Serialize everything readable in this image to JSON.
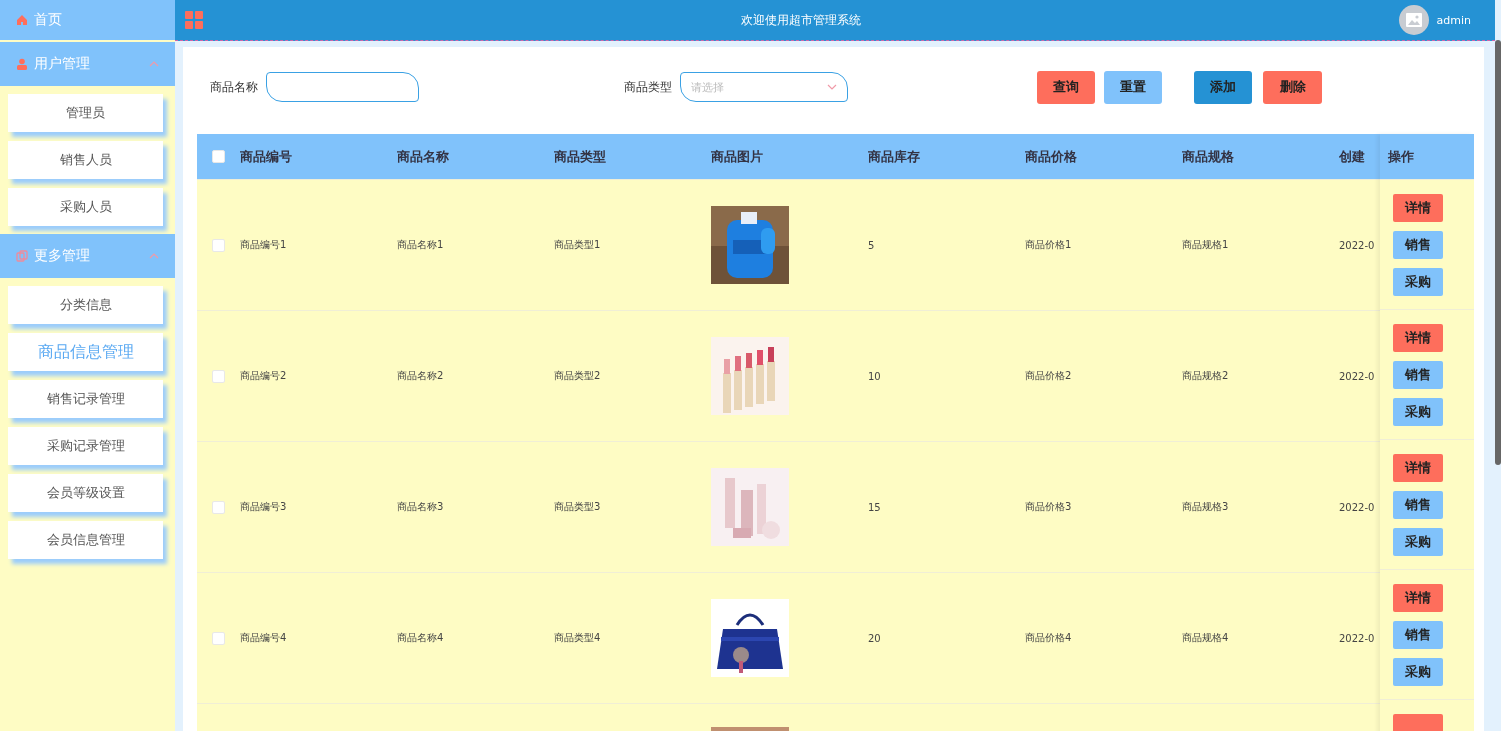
{
  "header": {
    "title": "欢迎使用超市管理系统",
    "user": "admin"
  },
  "sidebar": {
    "items": [
      {
        "label": "首页"
      },
      {
        "label": "用户管理",
        "expanded": true,
        "children": [
          {
            "label": "管理员",
            "selected": false
          },
          {
            "label": "销售人员",
            "selected": false
          },
          {
            "label": "采购人员",
            "selected": false
          }
        ]
      },
      {
        "label": "更多管理",
        "expanded": true,
        "children": [
          {
            "label": "分类信息",
            "selected": false
          },
          {
            "label": "商品信息管理",
            "selected": true
          },
          {
            "label": "销售记录管理",
            "selected": false
          },
          {
            "label": "采购记录管理",
            "selected": false
          },
          {
            "label": "会员等级设置",
            "selected": false
          },
          {
            "label": "会员信息管理",
            "selected": false
          }
        ]
      }
    ]
  },
  "search": {
    "fields": [
      {
        "label": "商品名称",
        "kind": "text"
      },
      {
        "label": "商品类型",
        "kind": "select",
        "placeholder": "请选择"
      }
    ],
    "buttons": [
      {
        "label": "查询",
        "color": "#fe6e5c"
      },
      {
        "label": "重置",
        "color": "#80c2fb"
      },
      {
        "label": "添加",
        "color": "#2592d4"
      },
      {
        "label": "删除",
        "color": "#fe6e5c"
      }
    ]
  },
  "table": {
    "select_all": {
      "checked": false
    },
    "columns": [
      "商品编号",
      "商品名称",
      "商品类型",
      "商品图片",
      "商品库存",
      "商品价格",
      "商品规格",
      "创建"
    ],
    "actions_column": "操作",
    "rows": [
      {
        "kind": "full",
        "checked": false,
        "cells": [
          "商品编号1",
          "商品名称1",
          "商品类型1",
          null,
          "5",
          "商品价格1",
          "商品规格1",
          "2022-0"
        ],
        "actions": [
          "详情",
          "销售",
          "采购"
        ]
      },
      {
        "kind": "full",
        "checked": false,
        "cells": [
          "商品编号2",
          "商品名称2",
          "商品类型2",
          null,
          "10",
          "商品价格2",
          "商品规格2",
          "2022-0"
        ],
        "actions": [
          "详情",
          "销售",
          "采购"
        ]
      },
      {
        "kind": "full",
        "checked": false,
        "cells": [
          "商品编号3",
          "商品名称3",
          "商品类型3",
          null,
          "15",
          "商品价格3",
          "商品规格3",
          "2022-0"
        ],
        "actions": [
          "详情",
          "销售",
          "采购"
        ]
      },
      {
        "kind": "full",
        "checked": false,
        "cells": [
          "商品编号4",
          "商品名称4",
          "商品类型4",
          null,
          "20",
          "商品价格4",
          "商品规格4",
          "2022-0"
        ],
        "actions": [
          "详情",
          "销售",
          "采购"
        ]
      },
      {
        "kind": "partial"
      }
    ]
  }
}
